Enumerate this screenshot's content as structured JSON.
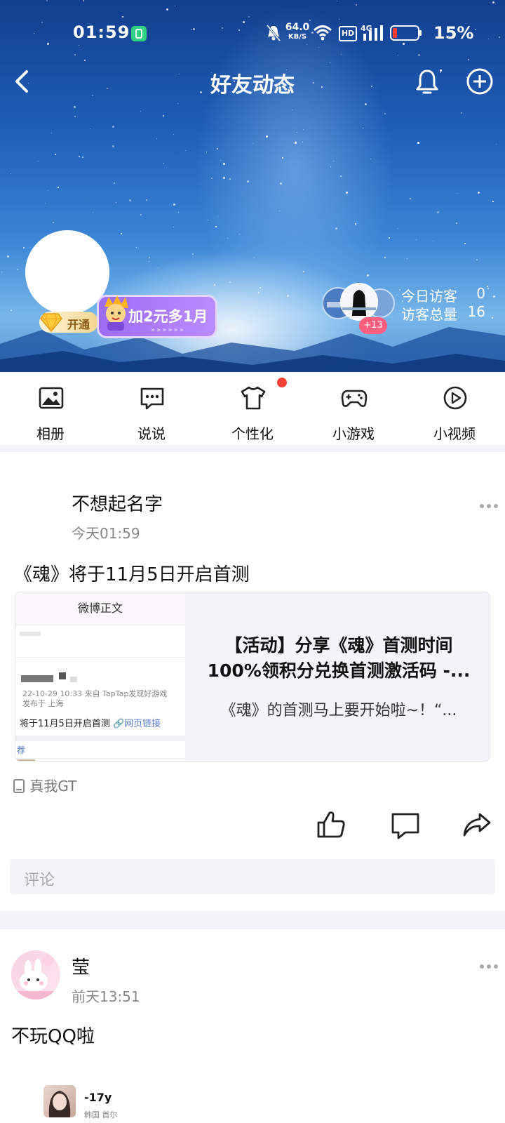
{
  "status_bar": {
    "time": "01:59",
    "net_speed_value": "64.0",
    "net_speed_unit": "KB/S",
    "hd": "HD",
    "network": "4G",
    "battery_pct": "15%"
  },
  "nav": {
    "title": "好友动态"
  },
  "profile": {
    "vip_label": "开通",
    "promo_label": "加2元多1月",
    "visitors_plus": "+13",
    "today_label": "今日访客",
    "today_count": "0",
    "total_label": "访客总量",
    "total_count": "16"
  },
  "tabs": [
    {
      "label": "相册",
      "icon": "album-icon"
    },
    {
      "label": "说说",
      "icon": "chat-icon"
    },
    {
      "label": "个性化",
      "icon": "shirt-icon"
    },
    {
      "label": "小游戏",
      "icon": "gamepad-icon"
    },
    {
      "label": "小视频",
      "icon": "video-icon"
    }
  ],
  "post1": {
    "author": "不想起名字",
    "time": "今天01:59",
    "text": "《魂》将于11月5日开启首测",
    "card": {
      "thumb_header": "微博正文",
      "thumb_meta1": "22-10-29 10:33  来自 TapTap发现好游戏",
      "thumb_meta2": "发布于 上海",
      "thumb_text": "将于11月5日开启首测",
      "thumb_link": "网页链接",
      "thumb_rec": "荐",
      "title_line1": "【活动】分享《魂》首测时间",
      "title_line2": "100%领积分兑换首测激活码 -...",
      "desc": "《魂》的首测马上要开始啦~！“..."
    },
    "device": "真我GT",
    "comment_placeholder": "评论"
  },
  "post2": {
    "author": "莹",
    "time": "前天13:51",
    "text": "不玩QQ啦",
    "sub_name": "-17y",
    "sub_loc": "韩国 首尔"
  },
  "colors": {
    "accent_red": "#f44336",
    "promo_purple": "#a878f8",
    "badge_pink": "#ff5f7e"
  }
}
